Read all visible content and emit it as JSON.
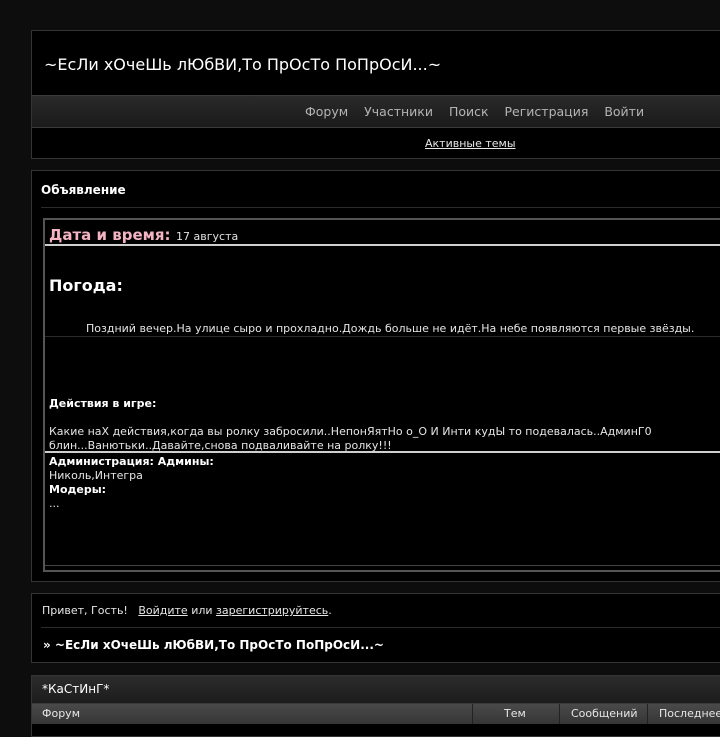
{
  "header": {
    "title": "~ЕсЛи хОчеШь лЮбВИ,То ПрОсТо ПоПрОсИ...~",
    "nav": [
      "Форум",
      "Участники",
      "Поиск",
      "Регистрация",
      "Войти"
    ],
    "active_topics": "Активные темы"
  },
  "announcement": {
    "heading": "Объявление",
    "datetime_label": "Дата и время:",
    "datetime_value": "17 августа",
    "weather_heading": "Погода:",
    "weather_text": "Поздний вечер.На улице сыро и прохладно.Дождь больше не идёт.На небе появляются первые звёзды.",
    "actions_heading": "Действия в игре:",
    "actions_line1": "Какие наХ действия,когда вы ролку забросили..НепонЯятНо о_О И Инти кудЫ то подевалась..АдминГ0",
    "actions_line2": "блин...Ванютьки..Давайте,снова подваливайте на ролку!!!",
    "admins_label": "Администрация: Админы:",
    "admins_names": "Николь,Интегра",
    "mods_label": "Модеры:",
    "mods_names": "..."
  },
  "welcome": {
    "greeting": "Привет, Гость!",
    "login": "Войдите",
    "or": "или",
    "register": "зарегистрируйтесь",
    "period": ".",
    "breadcrumb": "» ~ЕсЛи хОчеШь лЮбВИ,То ПрОсТо ПоПрОсИ...~"
  },
  "forum": {
    "category": "*КаСтИнГ*",
    "columns": [
      "Форум",
      "Тем",
      "Сообщений",
      "Последнее"
    ]
  }
}
